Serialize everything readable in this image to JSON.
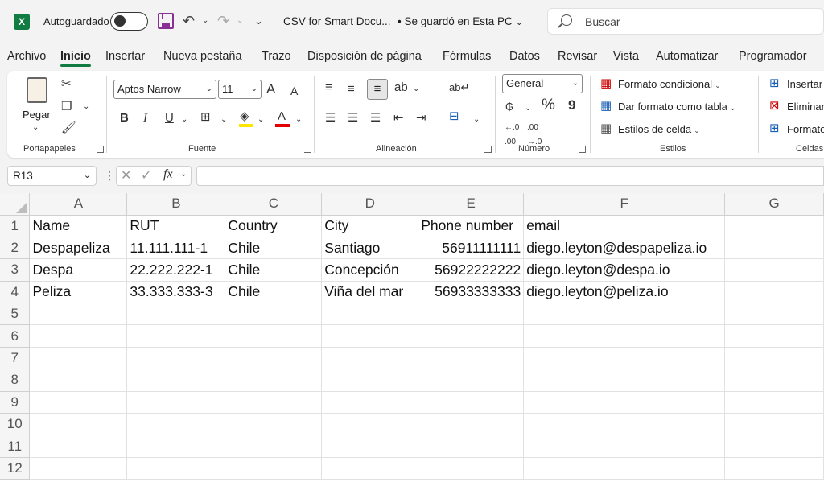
{
  "titlebar": {
    "autosave_label": "Autoguardado",
    "document_title": "CSV for Smart Docu...",
    "save_state": "• Se guardó en Esta PC",
    "search_placeholder": "Buscar"
  },
  "menu_tabs": [
    "Archivo",
    "Inicio",
    "Insertar",
    "Nueva pestaña",
    "Trazo",
    "Disposición de página",
    "Fórmulas",
    "Datos",
    "Revisar",
    "Vista",
    "Automatizar",
    "Programador"
  ],
  "active_tab": "Inicio",
  "ribbon": {
    "portapapeles": {
      "label": "Portapapeles",
      "paste": "Pegar"
    },
    "fuente": {
      "label": "Fuente",
      "font_name": "Aptos Narrow",
      "font_size": "11",
      "bold": "B",
      "italic": "I",
      "underline": "U",
      "grow": "A",
      "shrink": "A",
      "font_color_letter": "A"
    },
    "alineacion": {
      "label": "Alineación"
    },
    "numero": {
      "label": "Número",
      "format": "General",
      "percent": "%",
      "comma": "9"
    },
    "estilos": {
      "label": "Estilos",
      "items": [
        "Formato condicional",
        "Dar formato como tabla",
        "Estilos de celda"
      ]
    },
    "celdas": {
      "label": "Celdas",
      "items": [
        "Insertar",
        "Eliminar",
        "Formato"
      ]
    }
  },
  "formula_bar": {
    "name_box": "R13",
    "fx": "fx",
    "value": ""
  },
  "sheet": {
    "columns": [
      "A",
      "B",
      "C",
      "D",
      "E",
      "F",
      "G"
    ],
    "row_numbers": [
      "1",
      "2",
      "3",
      "4",
      "5",
      "6",
      "7",
      "8",
      "9",
      "10",
      "11",
      "12"
    ],
    "rows": [
      [
        "Name",
        "RUT",
        "Country",
        "City",
        "Phone number",
        "email",
        ""
      ],
      [
        "Despapeliza",
        "11.111.111-1",
        "Chile",
        "Santiago",
        "56911111111",
        "diego.leyton@despapeliza.io",
        ""
      ],
      [
        "Despa",
        "22.222.222-1",
        "Chile",
        "Concepción",
        "56922222222",
        "diego.leyton@despa.io",
        ""
      ],
      [
        "Peliza",
        "33.333.333-3",
        "Chile",
        "Viña del mar",
        "56933333333",
        "diego.leyton@peliza.io",
        ""
      ]
    ],
    "numeric_column": 4
  }
}
